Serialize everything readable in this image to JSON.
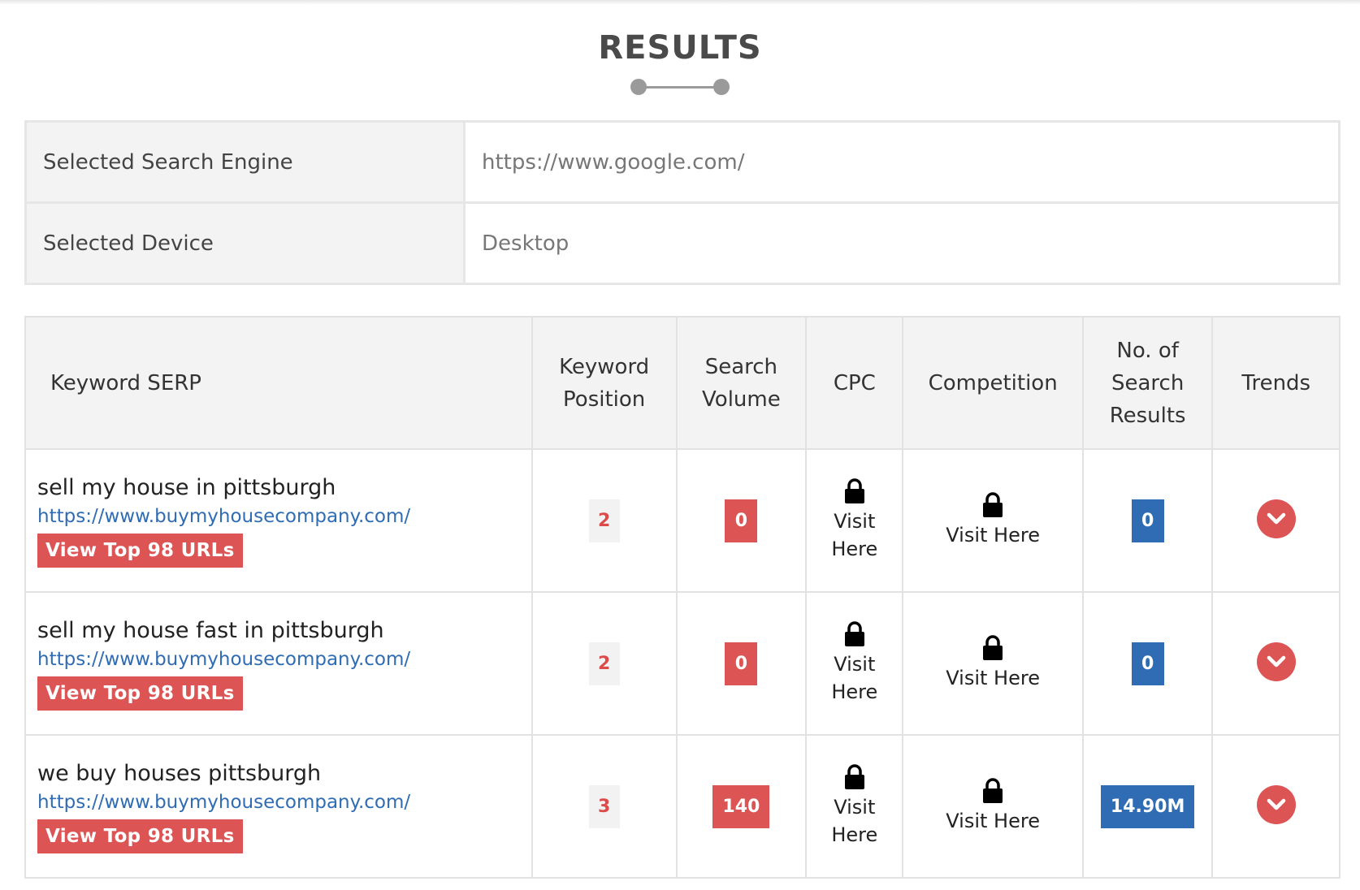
{
  "page": {
    "title": "RESULTS"
  },
  "settings": [
    {
      "label": "Selected Search Engine",
      "value": "https://www.google.com/"
    },
    {
      "label": "Selected Device",
      "value": "Desktop"
    }
  ],
  "table": {
    "headers": {
      "keyword": "Keyword SERP",
      "position": [
        "Keyword",
        "Position"
      ],
      "volume": [
        "Search",
        "Volume"
      ],
      "cpc": "CPC",
      "competition": "Competition",
      "results": [
        "No. of",
        "Search",
        "Results"
      ],
      "trends": "Trends"
    },
    "rows": [
      {
        "keyword": "sell my house in pittsburgh",
        "url": "https://www.buymyhousecompany.com/",
        "view_label": "View Top 98 URLs",
        "position": "2",
        "volume": "0",
        "cpc": [
          "Visit",
          "Here"
        ],
        "competition": "Visit Here",
        "results": "0"
      },
      {
        "keyword": "sell my house fast in pittsburgh",
        "url": "https://www.buymyhousecompany.com/",
        "view_label": "View Top 98 URLs",
        "position": "2",
        "volume": "0",
        "cpc": [
          "Visit",
          "Here"
        ],
        "competition": "Visit Here",
        "results": "0"
      },
      {
        "keyword": "we buy houses pittsburgh",
        "url": "https://www.buymyhousecompany.com/",
        "view_label": "View Top 98 URLs",
        "position": "3",
        "volume": "140",
        "cpc": [
          "Visit",
          "Here"
        ],
        "competition": "Visit Here",
        "results": "14.90M"
      }
    ]
  },
  "icons": {
    "lock": "lock-icon",
    "trend": "chevron-down-icon"
  },
  "colors": {
    "accent_red": "#dd5454",
    "accent_blue": "#2f6cb3",
    "header_bg": "#f3f3f3"
  }
}
